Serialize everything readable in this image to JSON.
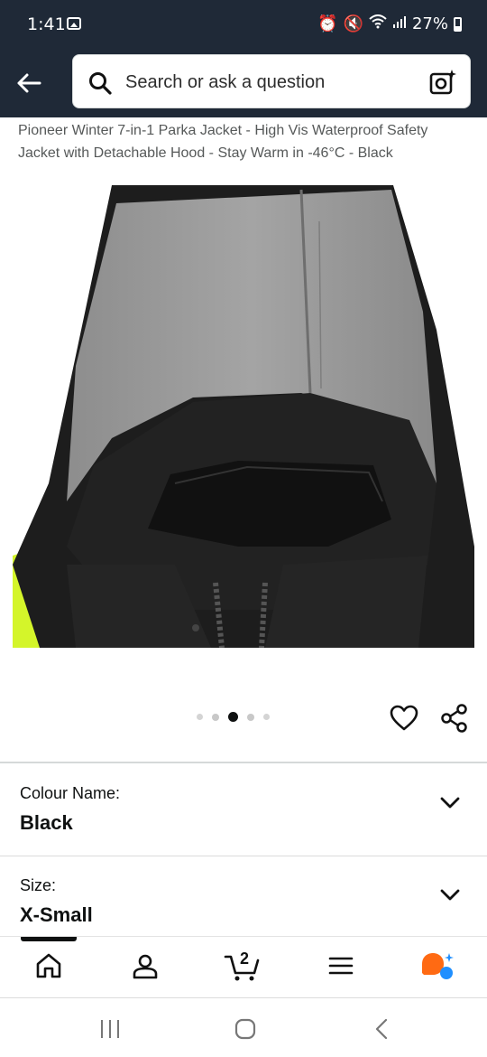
{
  "status_bar": {
    "time": "1:41",
    "battery": "27%"
  },
  "search": {
    "placeholder": "Search or ask a question"
  },
  "product": {
    "title": "Pioneer Winter 7-in-1 Parka Jacket - High Vis Waterproof Safety Jacket with Detachable Hood - Stay Warm in -46°C - Black",
    "image_count": 5,
    "active_image_index": 2
  },
  "selectors": {
    "colour": {
      "label": "Colour Name:",
      "value": "Black"
    },
    "size": {
      "label": "Size:",
      "value": "X-Small"
    }
  },
  "bottom_nav": {
    "cart_count": "2",
    "items": [
      "home-icon",
      "account-icon",
      "cart-icon",
      "menu-icon",
      "rufus-icon"
    ]
  },
  "colors": {
    "header_bg": "#1f2937",
    "hi_vis": "#d4f52a",
    "jacket": "#1a1a1a",
    "hood_lining": "#9a9a9a",
    "rufus_orange": "#ff6a13",
    "rufus_blue": "#1f8fff"
  }
}
